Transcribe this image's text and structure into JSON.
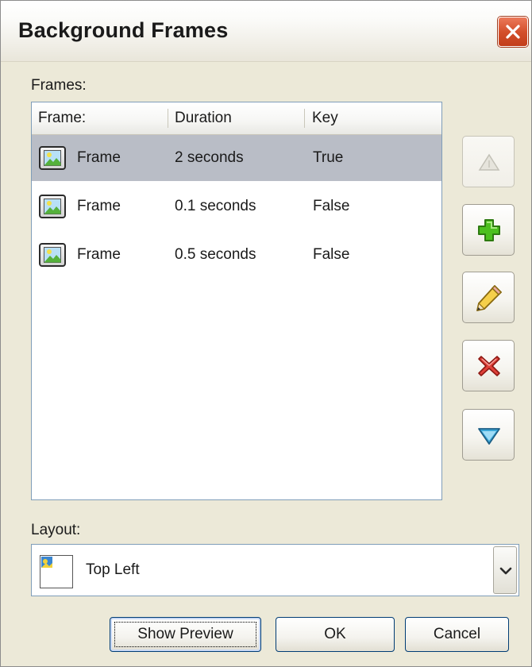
{
  "window": {
    "title": "Background Frames",
    "close_icon": "close-icon"
  },
  "frames_section": {
    "label": "Frames:",
    "columns": [
      "Frame:",
      "Duration",
      "Key"
    ],
    "rows": [
      {
        "icon": "image-frame-icon",
        "frame": "Frame",
        "duration": "2 seconds",
        "key": "True",
        "selected": true
      },
      {
        "icon": "image-frame-icon",
        "frame": "Frame",
        "duration": "0.1 seconds",
        "key": "False",
        "selected": false
      },
      {
        "icon": "image-frame-icon",
        "frame": "Frame",
        "duration": "0.5 seconds",
        "key": "False",
        "selected": false
      }
    ]
  },
  "side_buttons": [
    {
      "name": "move-up",
      "icon": "triangle-up-icon",
      "enabled": false
    },
    {
      "name": "add",
      "icon": "plus-icon",
      "enabled": true
    },
    {
      "name": "edit",
      "icon": "pencil-icon",
      "enabled": true
    },
    {
      "name": "delete",
      "icon": "x-icon",
      "enabled": true
    },
    {
      "name": "move-down",
      "icon": "triangle-down-icon",
      "enabled": true
    }
  ],
  "layout_section": {
    "label": "Layout:",
    "selected_value": "Top Left",
    "icon": "top-left-layout-icon"
  },
  "footer": {
    "show_preview_label": "Show Preview",
    "ok_label": "OK",
    "cancel_label": "Cancel"
  },
  "colors": {
    "dialog_bg": "#ece9d8",
    "selection_bg": "#b9bdc6",
    "close_red": "#d4502c",
    "add_green": "#4cc01e",
    "delete_red": "#e0413a",
    "down_blue": "#3ba7d8"
  }
}
